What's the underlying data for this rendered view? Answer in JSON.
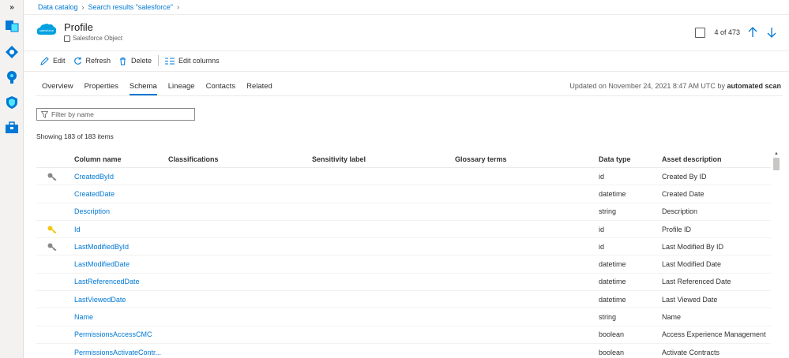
{
  "breadcrumb": [
    "Data catalog",
    "Search results \"salesforce\""
  ],
  "header": {
    "logo_text": "salesforce",
    "title": "Profile",
    "subtitle": "Salesforce Object",
    "pager_text": "4 of 473"
  },
  "toolbar": {
    "edit": "Edit",
    "refresh": "Refresh",
    "delete": "Delete",
    "edit_columns": "Edit columns"
  },
  "tabs": [
    "Overview",
    "Properties",
    "Schema",
    "Lineage",
    "Contacts",
    "Related"
  ],
  "active_tab": "Schema",
  "updated": {
    "prefix": "Updated on November 24, 2021 8:47 AM UTC by",
    "source": "automated scan"
  },
  "filter": {
    "placeholder": "Filter by name"
  },
  "showing": "Showing 183 of 183 items",
  "table": {
    "headers": [
      "Column name",
      "Classifications",
      "Sensitivity label",
      "Glossary terms",
      "Data type",
      "Asset description"
    ],
    "rows": [
      {
        "key": "foreign",
        "name": "CreatedById",
        "type": "id",
        "desc": "Created By ID"
      },
      {
        "key": "",
        "name": "CreatedDate",
        "type": "datetime",
        "desc": "Created Date"
      },
      {
        "key": "",
        "name": "Description",
        "type": "string",
        "desc": "Description"
      },
      {
        "key": "primary",
        "name": "Id",
        "type": "id",
        "desc": "Profile ID"
      },
      {
        "key": "foreign",
        "name": "LastModifiedById",
        "type": "id",
        "desc": "Last Modified By ID"
      },
      {
        "key": "",
        "name": "LastModifiedDate",
        "type": "datetime",
        "desc": "Last Modified Date"
      },
      {
        "key": "",
        "name": "LastReferencedDate",
        "type": "datetime",
        "desc": "Last Referenced Date"
      },
      {
        "key": "",
        "name": "LastViewedDate",
        "type": "datetime",
        "desc": "Last Viewed Date"
      },
      {
        "key": "",
        "name": "Name",
        "type": "string",
        "desc": "Name"
      },
      {
        "key": "",
        "name": "PermissionsAccessCMC",
        "type": "boolean",
        "desc": "Access Experience Management"
      },
      {
        "key": "",
        "name": "PermissionsActivateContr...",
        "type": "boolean",
        "desc": "Activate Contracts"
      }
    ]
  },
  "colors": {
    "accent": "#0078d4",
    "primary_key": "#f2c811",
    "foreign_key": "#8a8886",
    "salesforce": "#00a1e0"
  }
}
